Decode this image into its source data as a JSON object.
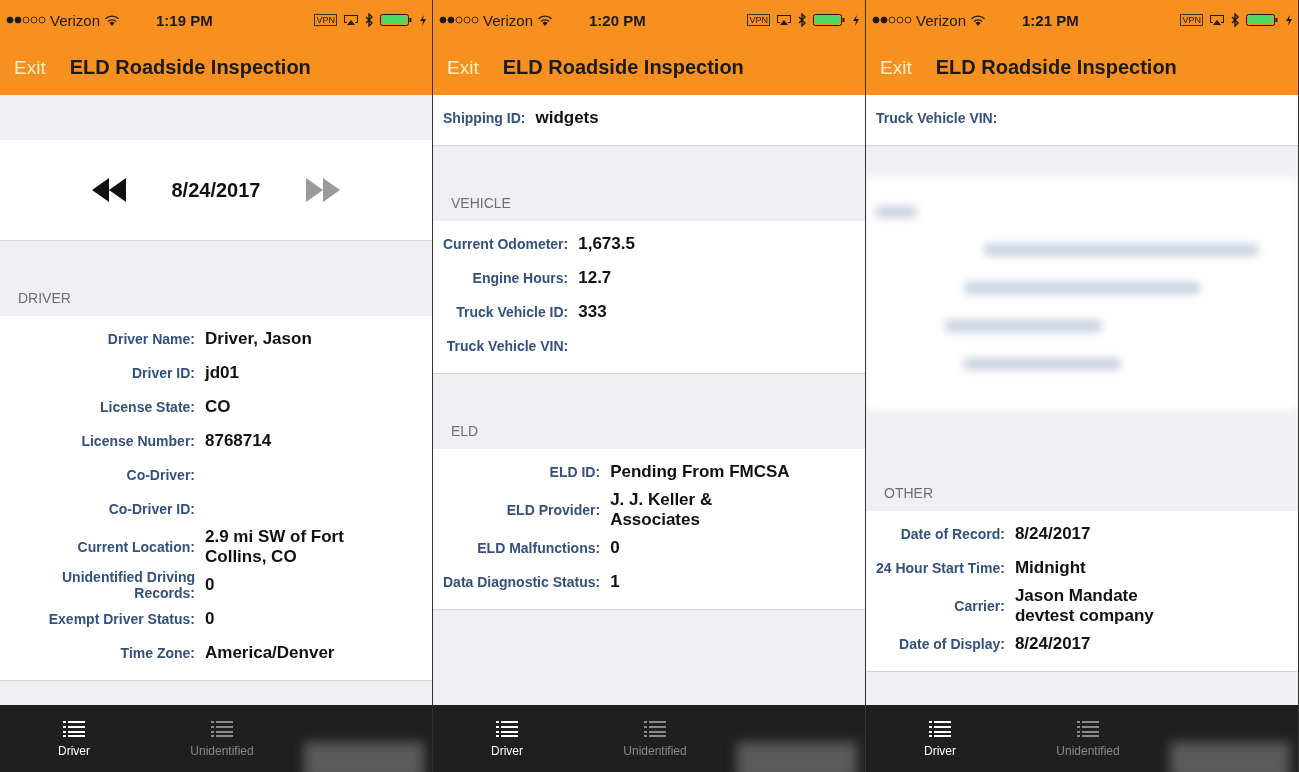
{
  "phones": [
    {
      "status_bar": {
        "carrier": "Verizon",
        "time": "1:19 PM",
        "vpn": "VPN"
      },
      "nav_bar": {
        "exit": "Exit",
        "title": "ELD Roadside Inspection"
      },
      "content": [
        {
          "kind": "spacer"
        },
        {
          "kind": "date_nav",
          "date": "8/24/2017",
          "prev_disabled": false,
          "next_disabled": true
        },
        {
          "kind": "section",
          "header": "DRIVER",
          "rows": [
            {
              "label": "Driver Name:",
              "value": "Driver, Jason"
            },
            {
              "label": "Driver ID:",
              "value": "jd01"
            },
            {
              "label": "License State:",
              "value": "CO"
            },
            {
              "label": "License Number:",
              "value": "8768714"
            },
            {
              "label": "Co-Driver:"
            },
            {
              "label": "Co-Driver ID:"
            },
            {
              "label": "Current Location:",
              "value": "2.9 mi SW of Fort Collins, CO"
            },
            {
              "label": "Unidentified Driving Records:",
              "value": "0"
            },
            {
              "label": "Exempt Driver Status:",
              "value": "0"
            },
            {
              "label": "Time Zone:",
              "value": "America/Denver"
            }
          ]
        }
      ],
      "tabs": [
        {
          "kind": "tab",
          "label": "Driver",
          "selected": true
        },
        {
          "kind": "tab",
          "label": "Unidentified",
          "selected": false
        },
        {
          "kind": "blurred",
          "selected": false
        }
      ]
    },
    {
      "status_bar": {
        "carrier": "Verizon",
        "time": "1:20 PM",
        "vpn": "VPN"
      },
      "nav_bar": {
        "exit": "Exit",
        "title": "ELD Roadside Inspection"
      },
      "content": [
        {
          "kind": "rows",
          "rows": [
            {
              "label": "Shipping ID:",
              "value": "widgets"
            }
          ]
        },
        {
          "kind": "section",
          "header": "VEHICLE",
          "rows": [
            {
              "label": "Current Odometer:",
              "value": "1,673.5"
            },
            {
              "label": "Engine Hours:",
              "value": "12.7"
            },
            {
              "label": "Truck Vehicle ID:",
              "value": "333"
            },
            {
              "label": "Truck Vehicle VIN:"
            }
          ]
        },
        {
          "kind": "section",
          "header": "ELD",
          "rows": [
            {
              "label": "ELD ID:",
              "value": "Pending From FMCSA"
            },
            {
              "label": "ELD Provider:",
              "value": "J. J. Keller & Associates"
            },
            {
              "label": "ELD Malfunctions:",
              "value": "0"
            },
            {
              "label": "Data Diagnostic Status:",
              "value": "1"
            }
          ]
        }
      ],
      "tabs": [
        {
          "kind": "tab",
          "label": "Driver",
          "selected": true
        },
        {
          "kind": "tab",
          "label": "Unidentified",
          "selected": false
        },
        {
          "kind": "blurred",
          "selected": false
        }
      ]
    },
    {
      "status_bar": {
        "carrier": "Verizon",
        "time": "1:21 PM",
        "vpn": "VPN"
      },
      "nav_bar": {
        "exit": "Exit",
        "title": "ELD Roadside Inspection"
      },
      "content": [
        {
          "kind": "rows",
          "rows": [
            {
              "label": "Truck Vehicle VIN:"
            }
          ]
        },
        {
          "kind": "blurred"
        },
        {
          "kind": "section",
          "header": "OTHER",
          "rows": [
            {
              "label": "Date of Record:",
              "value": "8/24/2017"
            },
            {
              "label": "24 Hour Start Time:",
              "value": "Midnight"
            },
            {
              "label": "Carrier:",
              "value": "Jason Mandate devtest company"
            },
            {
              "label": "Date of Display:",
              "value": "8/24/2017"
            }
          ]
        }
      ],
      "tabs": [
        {
          "kind": "tab",
          "label": "Driver",
          "selected": true
        },
        {
          "kind": "tab",
          "label": "Unidentified",
          "selected": false
        },
        {
          "kind": "blurred",
          "selected": false
        }
      ]
    }
  ]
}
